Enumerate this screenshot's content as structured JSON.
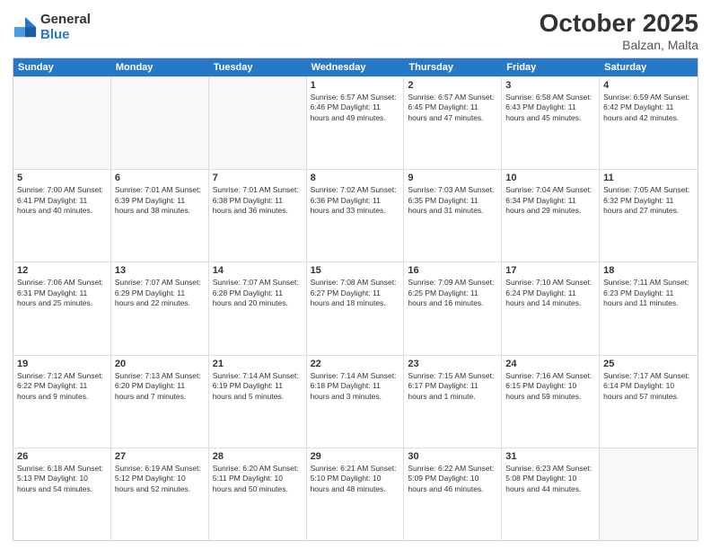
{
  "header": {
    "logo_general": "General",
    "logo_blue": "Blue",
    "month_title": "October 2025",
    "location": "Balzan, Malta"
  },
  "weekdays": [
    "Sunday",
    "Monday",
    "Tuesday",
    "Wednesday",
    "Thursday",
    "Friday",
    "Saturday"
  ],
  "rows": [
    [
      {
        "day": "",
        "info": "",
        "empty": true
      },
      {
        "day": "",
        "info": "",
        "empty": true
      },
      {
        "day": "",
        "info": "",
        "empty": true
      },
      {
        "day": "1",
        "info": "Sunrise: 6:57 AM\nSunset: 6:46 PM\nDaylight: 11 hours\nand 49 minutes."
      },
      {
        "day": "2",
        "info": "Sunrise: 6:57 AM\nSunset: 6:45 PM\nDaylight: 11 hours\nand 47 minutes."
      },
      {
        "day": "3",
        "info": "Sunrise: 6:58 AM\nSunset: 6:43 PM\nDaylight: 11 hours\nand 45 minutes."
      },
      {
        "day": "4",
        "info": "Sunrise: 6:59 AM\nSunset: 6:42 PM\nDaylight: 11 hours\nand 42 minutes."
      }
    ],
    [
      {
        "day": "5",
        "info": "Sunrise: 7:00 AM\nSunset: 6:41 PM\nDaylight: 11 hours\nand 40 minutes."
      },
      {
        "day": "6",
        "info": "Sunrise: 7:01 AM\nSunset: 6:39 PM\nDaylight: 11 hours\nand 38 minutes."
      },
      {
        "day": "7",
        "info": "Sunrise: 7:01 AM\nSunset: 6:38 PM\nDaylight: 11 hours\nand 36 minutes."
      },
      {
        "day": "8",
        "info": "Sunrise: 7:02 AM\nSunset: 6:36 PM\nDaylight: 11 hours\nand 33 minutes."
      },
      {
        "day": "9",
        "info": "Sunrise: 7:03 AM\nSunset: 6:35 PM\nDaylight: 11 hours\nand 31 minutes."
      },
      {
        "day": "10",
        "info": "Sunrise: 7:04 AM\nSunset: 6:34 PM\nDaylight: 11 hours\nand 29 minutes."
      },
      {
        "day": "11",
        "info": "Sunrise: 7:05 AM\nSunset: 6:32 PM\nDaylight: 11 hours\nand 27 minutes."
      }
    ],
    [
      {
        "day": "12",
        "info": "Sunrise: 7:06 AM\nSunset: 6:31 PM\nDaylight: 11 hours\nand 25 minutes."
      },
      {
        "day": "13",
        "info": "Sunrise: 7:07 AM\nSunset: 6:29 PM\nDaylight: 11 hours\nand 22 minutes."
      },
      {
        "day": "14",
        "info": "Sunrise: 7:07 AM\nSunset: 6:28 PM\nDaylight: 11 hours\nand 20 minutes."
      },
      {
        "day": "15",
        "info": "Sunrise: 7:08 AM\nSunset: 6:27 PM\nDaylight: 11 hours\nand 18 minutes."
      },
      {
        "day": "16",
        "info": "Sunrise: 7:09 AM\nSunset: 6:25 PM\nDaylight: 11 hours\nand 16 minutes."
      },
      {
        "day": "17",
        "info": "Sunrise: 7:10 AM\nSunset: 6:24 PM\nDaylight: 11 hours\nand 14 minutes."
      },
      {
        "day": "18",
        "info": "Sunrise: 7:11 AM\nSunset: 6:23 PM\nDaylight: 11 hours\nand 11 minutes."
      }
    ],
    [
      {
        "day": "19",
        "info": "Sunrise: 7:12 AM\nSunset: 6:22 PM\nDaylight: 11 hours\nand 9 minutes."
      },
      {
        "day": "20",
        "info": "Sunrise: 7:13 AM\nSunset: 6:20 PM\nDaylight: 11 hours\nand 7 minutes."
      },
      {
        "day": "21",
        "info": "Sunrise: 7:14 AM\nSunset: 6:19 PM\nDaylight: 11 hours\nand 5 minutes."
      },
      {
        "day": "22",
        "info": "Sunrise: 7:14 AM\nSunset: 6:18 PM\nDaylight: 11 hours\nand 3 minutes."
      },
      {
        "day": "23",
        "info": "Sunrise: 7:15 AM\nSunset: 6:17 PM\nDaylight: 11 hours\nand 1 minute."
      },
      {
        "day": "24",
        "info": "Sunrise: 7:16 AM\nSunset: 6:15 PM\nDaylight: 10 hours\nand 59 minutes."
      },
      {
        "day": "25",
        "info": "Sunrise: 7:17 AM\nSunset: 6:14 PM\nDaylight: 10 hours\nand 57 minutes."
      }
    ],
    [
      {
        "day": "26",
        "info": "Sunrise: 6:18 AM\nSunset: 5:13 PM\nDaylight: 10 hours\nand 54 minutes."
      },
      {
        "day": "27",
        "info": "Sunrise: 6:19 AM\nSunset: 5:12 PM\nDaylight: 10 hours\nand 52 minutes."
      },
      {
        "day": "28",
        "info": "Sunrise: 6:20 AM\nSunset: 5:11 PM\nDaylight: 10 hours\nand 50 minutes."
      },
      {
        "day": "29",
        "info": "Sunrise: 6:21 AM\nSunset: 5:10 PM\nDaylight: 10 hours\nand 48 minutes."
      },
      {
        "day": "30",
        "info": "Sunrise: 6:22 AM\nSunset: 5:09 PM\nDaylight: 10 hours\nand 46 minutes."
      },
      {
        "day": "31",
        "info": "Sunrise: 6:23 AM\nSunset: 5:08 PM\nDaylight: 10 hours\nand 44 minutes."
      },
      {
        "day": "",
        "info": "",
        "empty": true
      }
    ]
  ]
}
